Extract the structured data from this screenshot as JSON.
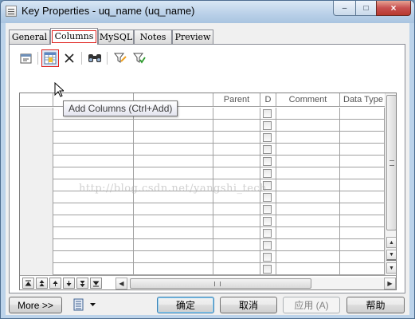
{
  "window": {
    "title": "Key Properties - uq_name (uq_name)",
    "buttons": {
      "minimize": "–",
      "maximize": "□",
      "close": "×"
    }
  },
  "tabs": [
    {
      "label": "General"
    },
    {
      "label": "Columns",
      "active": true
    },
    {
      "label": "MySQL"
    },
    {
      "label": "Notes"
    },
    {
      "label": "Preview"
    }
  ],
  "toolbar": {
    "items": [
      "properties-icon",
      "add-columns-icon",
      "delete-icon",
      "find-icon",
      "filter-icon",
      "clear-filter-icon"
    ]
  },
  "tooltip": {
    "text": "Add Columns (Ctrl+Add)"
  },
  "grid": {
    "columns": [
      "",
      "",
      "",
      "Parent",
      "D",
      "Comment",
      "Data Type"
    ],
    "row_count": 14
  },
  "nav_buttons": [
    "first",
    "page-up",
    "up",
    "down",
    "page-down",
    "last"
  ],
  "footer": {
    "more_label": "More >>",
    "ok_label": "确定",
    "cancel_label": "取消",
    "apply_label": "应用 (A)",
    "help_label": "帮助"
  },
  "watermark": {
    "text": "http://blog.csdn.net/yangshi_tech"
  },
  "colors": {
    "highlight_red": "#e0201b",
    "window_frame": "#bcd3ea",
    "default_button": "#3c7fb1"
  }
}
